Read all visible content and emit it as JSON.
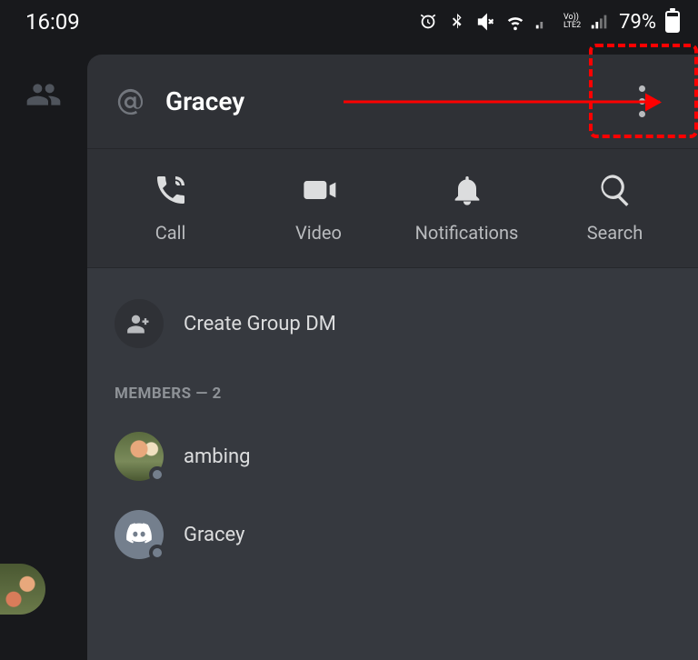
{
  "status": {
    "time": "16:09",
    "battery_pct": "79%"
  },
  "header": {
    "username": "Gracey"
  },
  "actions": {
    "call": "Call",
    "video": "Video",
    "notifications": "Notifications",
    "search": "Search"
  },
  "create_group": {
    "label": "Create Group DM"
  },
  "members_heading": "Members — 2",
  "members": [
    {
      "name": "ambing"
    },
    {
      "name": "Gracey"
    }
  ],
  "lte_label": "Vo))\nLTE2"
}
